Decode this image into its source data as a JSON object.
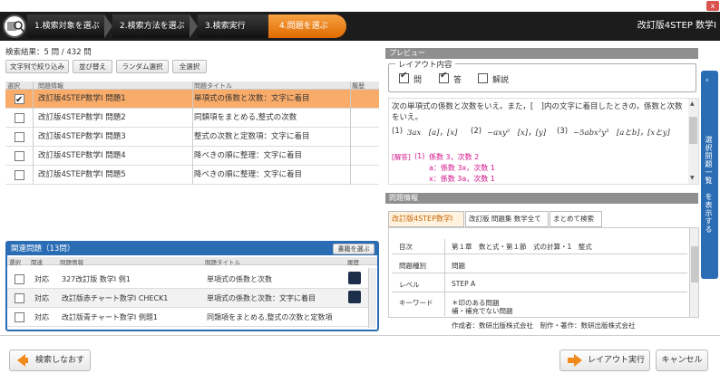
{
  "window": {
    "close_label": "x"
  },
  "header": {
    "steps": [
      {
        "label": "1.検索対象を選ぶ"
      },
      {
        "label": "2.検索方法を選ぶ"
      },
      {
        "label": "3.検索実行"
      },
      {
        "label": "4.問題を選ぶ"
      }
    ],
    "app_title": "改訂版4STEP 数学Ⅰ"
  },
  "search": {
    "result_label": "検索結果：5 問 / 432 問",
    "buttons": [
      "文字列で絞り込み",
      "並び替え",
      "ランダム選択",
      "全選択"
    ]
  },
  "grid": {
    "columns": [
      "選択",
      "問題情報",
      "問題タイトル",
      "履歴"
    ],
    "rows": [
      {
        "info": "改訂版4STEP数学Ⅰ 問題1",
        "title": "単項式の係数と次数：文字に着目",
        "selected": true
      },
      {
        "info": "改訂版4STEP数学Ⅰ 問題2",
        "title": "同類項をまとめる,整式の次数",
        "selected": false
      },
      {
        "info": "改訂版4STEP数学Ⅰ 問題3",
        "title": "整式の次数と定数項：文字に着目",
        "selected": false
      },
      {
        "info": "改訂版4STEP数学Ⅰ 問題4",
        "title": "降べきの順に整理：文字に着目",
        "selected": false
      },
      {
        "info": "改訂版4STEP数学Ⅰ 問題5",
        "title": "降べきの順に整理：文字に着目",
        "selected": false
      }
    ]
  },
  "related": {
    "title": "関連問題（13問）",
    "button": "書籍を選ぶ",
    "columns": [
      "選択",
      "関連",
      "問題情報",
      "問題タイトル",
      "履歴"
    ],
    "rows": [
      {
        "rel": "対応",
        "info": "327改訂版 数学Ⅰ 例1",
        "title": "単項式の係数と次数"
      },
      {
        "rel": "対応",
        "info": "改訂版赤チャート数学Ⅰ CHECK1",
        "title": "単項式の係数と次数：文字に着目"
      },
      {
        "rel": "対応",
        "info": "改訂版青チャート数学Ⅰ 例題1",
        "title": "同類項をまとめる,整式の次数と定数項"
      }
    ]
  },
  "preview": {
    "title": "プレビュー",
    "layout_legend": "レイアウト内容",
    "options": [
      {
        "label": "問",
        "checked": true
      },
      {
        "label": "答",
        "checked": true
      },
      {
        "label": "解説",
        "checked": false
      }
    ],
    "question_text_1": "次の単項式の係数と次数をいえ。また，[　]内の文字に着目したときの，係数と次数をいえ。",
    "q1_num": "(1)",
    "q1_expr": "3ax　[a]，[x]",
    "q2_num": "(2)",
    "q2_expr": "−axy²　[x]，[y]",
    "q3_num": "(3)",
    "q3_expr": "−5abx²y³　[aとb]，[xとy]",
    "answer_tag": "[解答]",
    "answer_num": "(1)",
    "answer_line1": "係数 3，次数 2",
    "answer_line2": "a：係数 3x，次数 1",
    "answer_line3": "x：係数 3a，次数 1"
  },
  "side_tab": {
    "label": "選択問題一覧　を表示する"
  },
  "info": {
    "title": "問題情報",
    "tabs": [
      "改訂版4STEP数学Ⅰ",
      "改訂版 問題集 数学全て",
      "まとめて検索"
    ],
    "rows": [
      {
        "key": "目次",
        "value": "第１章　数と式・第１節　式の計算・1　整式"
      },
      {
        "key": "問題種別",
        "value": "問題"
      },
      {
        "key": "レベル",
        "value": "STEP A"
      },
      {
        "key": "キーワード",
        "value": "＊印のある問題"
      },
      {
        "key": "",
        "value": "補・補充でない問題"
      }
    ],
    "credit": "作成者：数研出版株式会社　制作・著作：数研出版株式会社"
  },
  "footer": {
    "back": "検索しなおす",
    "layout": "レイアウト実行",
    "cancel": "キャンセル"
  },
  "colors": {
    "accent": "#f08a1c",
    "blue": "#2a6db5",
    "selected_row": "#f9ac6a"
  }
}
